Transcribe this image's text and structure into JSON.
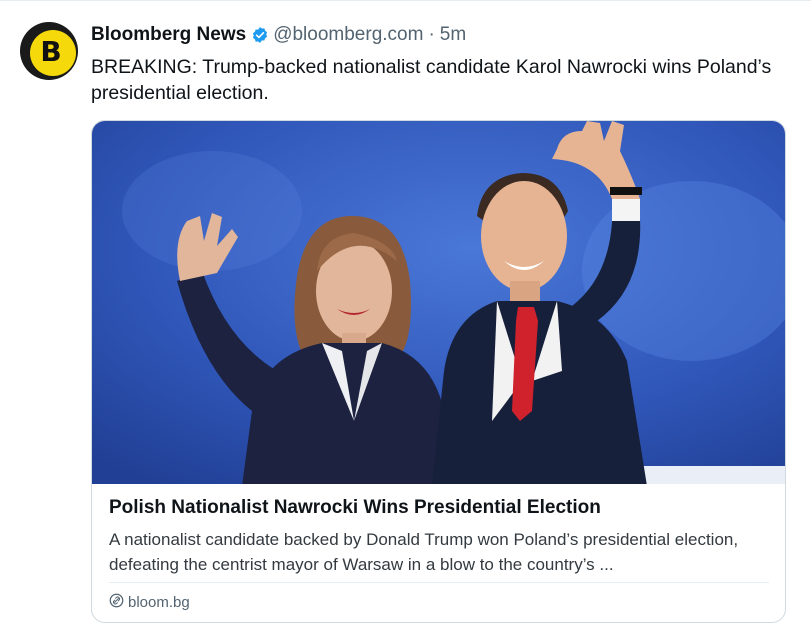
{
  "post": {
    "avatar_letter": "B",
    "author_name": "Bloomberg News",
    "handle": "@bloomberg.com",
    "separator": "·",
    "time": "5m",
    "text": "BREAKING: Trump-backed nationalist candidate Karol Nawrocki wins Poland’s presidential election."
  },
  "card": {
    "title": "Polish Nationalist Nawrocki Wins Presidential Election",
    "description": "A nationalist candidate backed by Donald Trump won Poland’s presidential election, defeating the centrist mayor of Warsaw in a blow to the country’s ...",
    "domain": "bloom.bg"
  },
  "icons": {
    "verified": "verified-badge-icon",
    "link": "link-icon"
  },
  "colors": {
    "brand_yellow": "#f5d90a",
    "verified_blue": "#1d9bf0",
    "muted": "#536471",
    "photo_background": "#2f56b8"
  }
}
